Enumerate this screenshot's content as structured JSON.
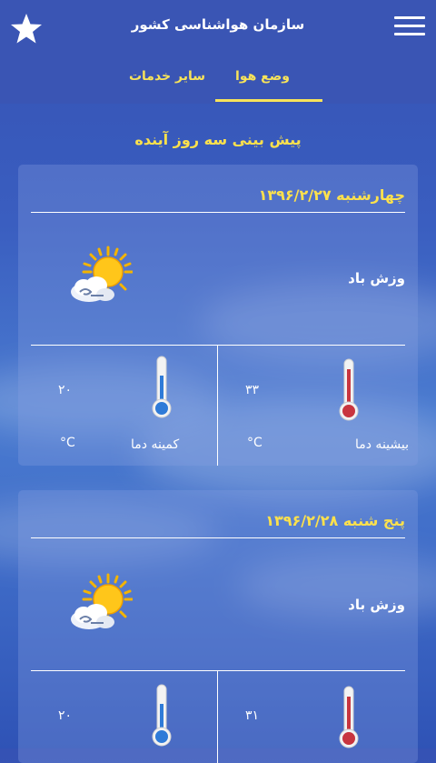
{
  "header": {
    "title": "سازمان هواشناسی کشور"
  },
  "tabs": [
    {
      "label": "وضع هوا",
      "active": true
    },
    {
      "label": "سایر خدمات",
      "active": false
    }
  ],
  "forecast_heading": "پیش بینی سه روز آینده",
  "days": [
    {
      "date": "چهارشنبه ۱۳۹۶/۲/۲۷",
      "condition": "وزش باد",
      "icon": "sun-cloud-wind-icon",
      "max_temp": "۳۳",
      "max_label": "بیشینه دما",
      "min_temp": "۲۰",
      "min_label": "کمینه دما",
      "unit": "°C"
    },
    {
      "date": "پنج شنبه ۱۳۹۶/۲/۲۸",
      "condition": "وزش باد",
      "icon": "sun-cloud-wind-icon",
      "max_temp": "۳۱",
      "min_temp": "۲۰"
    }
  ],
  "colors": {
    "accent": "#fde14c",
    "header_bg": "#3a55b4",
    "max_thermometer": "#c8353f",
    "min_thermometer": "#2f7bd8"
  }
}
